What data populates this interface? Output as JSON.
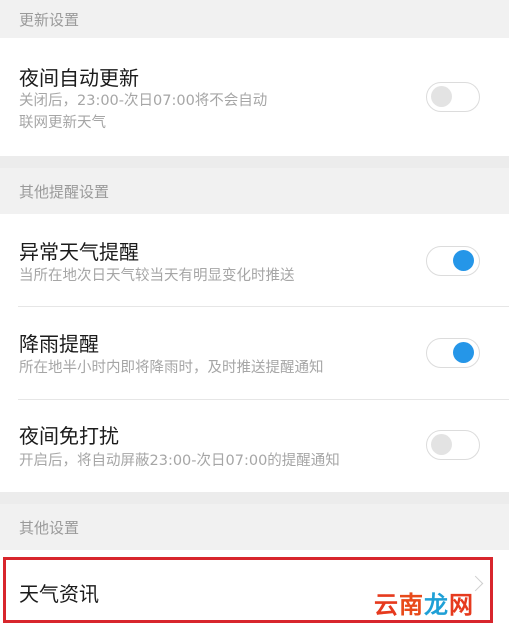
{
  "sections": [
    {
      "header": "更新设置",
      "rows": [
        {
          "title": "夜间自动更新",
          "description": "关闭后，23:00-次日07:00将不会自动\n联网更新天气",
          "toggle_on": false
        }
      ]
    },
    {
      "header": "其他提醒设置",
      "rows": [
        {
          "title": "异常天气提醒",
          "description": "当所在地次日天气较当天有明显变化时推送",
          "toggle_on": true
        },
        {
          "title": "降雨提醒",
          "description": "所在地半小时内即将降雨时，及时推送提醒通知",
          "toggle_on": true
        },
        {
          "title": "夜间免打扰",
          "description": "开启后，将自动屏蔽23:00-次日07:00的提醒通知",
          "toggle_on": false
        }
      ]
    },
    {
      "header": "其他设置",
      "rows": [
        {
          "title": "天气资讯"
        }
      ]
    }
  ],
  "watermark": {
    "part1": "云",
    "part2": "南",
    "part3": "龙",
    "part4": "网"
  },
  "colors": {
    "toggle_on": "#2596e8",
    "highlight": "#d8262d"
  }
}
